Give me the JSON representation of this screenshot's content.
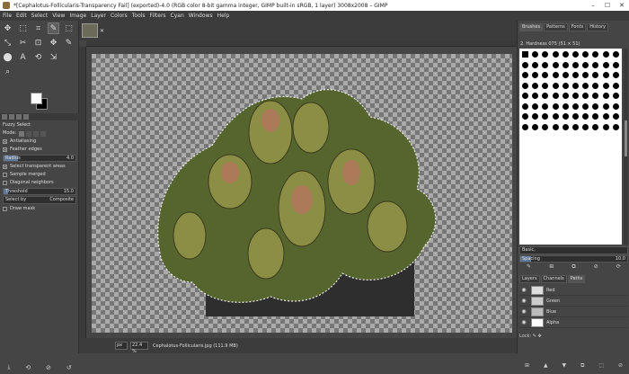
{
  "window": {
    "title": "*[Cephalotus-Follicularis-Transparency Fail] (exported)-4.0 (RGB color 8-bit gamma integer, GIMP built-in sRGB, 1 layer) 3008x2008 – GIMP",
    "minimize": "–",
    "maximize": "☐",
    "close": "✕"
  },
  "menu": [
    "File",
    "Edit",
    "Select",
    "View",
    "Image",
    "Layer",
    "Colors",
    "Tools",
    "Filters",
    "Cyan",
    "Windows",
    "Help"
  ],
  "toolbox": {
    "tools": [
      "✥",
      "⬚",
      "⌗",
      "✎",
      "⬚",
      "⤡",
      "✂",
      "⊡",
      "✥",
      "✎",
      "⬤",
      "A",
      "⟲",
      "⇲",
      "⌕"
    ]
  },
  "tool_options": {
    "title": "Fuzzy Select",
    "mode_label": "Mode:",
    "antialiasing": "Antialiasing",
    "feather_edges": "Feather edges",
    "radius_label": "Radius",
    "radius_value": "4.0",
    "select_transparent": "Select transparent areas",
    "sample_merged": "Sample merged",
    "diagonal_neighbors": "Diagonal neighbors",
    "threshold_label": "Threshold",
    "threshold_value": "15.0",
    "select_by_label": "Select by",
    "select_by_value": "Composite",
    "draw_mask": "Draw mask"
  },
  "status": {
    "unit": "px",
    "zoom": "22.4 %",
    "message": "Cephalotus-Follicularis.jpg (111.9 MB)"
  },
  "right_panel": {
    "tabs": [
      "Brushes",
      "Patterns",
      "Fonts",
      "History"
    ],
    "brush_name": "2. Hardness 075 (51 × 51)",
    "preset": "Basic,",
    "spacing_label": "Spacing",
    "spacing_value": "10.0",
    "layer_tabs": [
      "Layers",
      "Channels",
      "Paths"
    ],
    "channels": [
      "Red",
      "Green",
      "Blue",
      "Alpha"
    ],
    "lock_label": "Lock:"
  }
}
